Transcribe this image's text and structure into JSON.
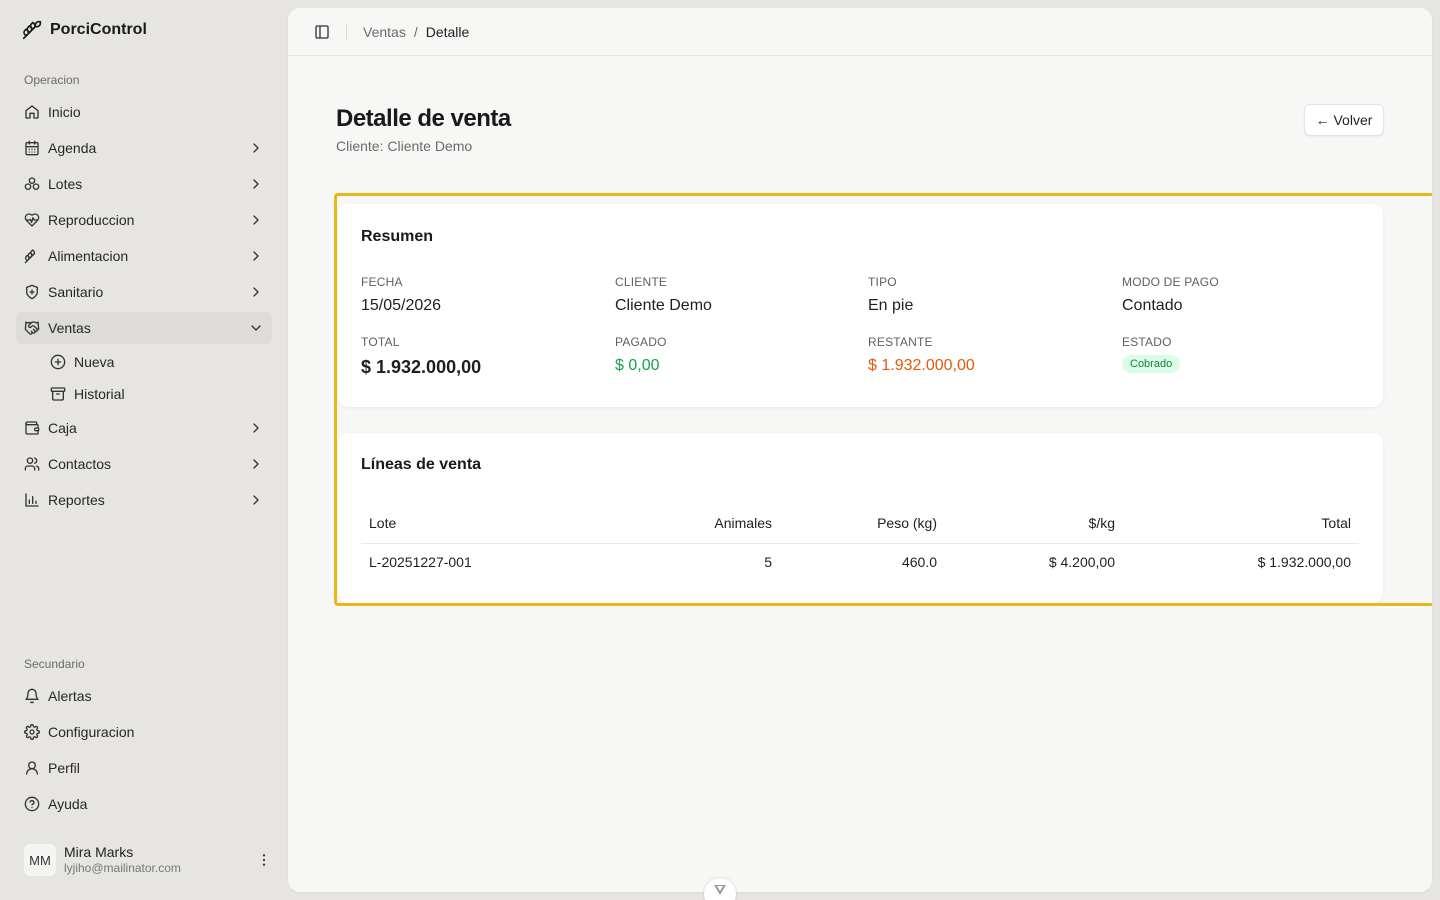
{
  "app": {
    "name": "PorciControl"
  },
  "sidebar": {
    "section_primary": "Operacion",
    "primary": [
      {
        "label": "Inicio",
        "icon": "home-icon"
      },
      {
        "label": "Agenda",
        "icon": "calendar-icon"
      },
      {
        "label": "Lotes",
        "icon": "boxes-icon"
      },
      {
        "label": "Reproduccion",
        "icon": "heart-pulse-icon"
      },
      {
        "label": "Alimentacion",
        "icon": "wheat-icon"
      },
      {
        "label": "Sanitario",
        "icon": "shield-icon"
      },
      {
        "label": "Ventas",
        "icon": "handshake-icon",
        "active": true
      }
    ],
    "ventas_sub": [
      {
        "label": "Nueva",
        "icon": "plus-circle-icon"
      },
      {
        "label": "Historial",
        "icon": "archive-icon"
      }
    ],
    "primary_after": [
      {
        "label": "Caja",
        "icon": "wallet-icon"
      },
      {
        "label": "Contactos",
        "icon": "users-icon"
      },
      {
        "label": "Reportes",
        "icon": "bar-chart-icon"
      }
    ],
    "section_secondary": "Secundario",
    "secondary": [
      {
        "label": "Alertas",
        "icon": "bell-icon"
      },
      {
        "label": "Configuracion",
        "icon": "gear-icon"
      },
      {
        "label": "Perfil",
        "icon": "user-icon"
      },
      {
        "label": "Ayuda",
        "icon": "help-circle-icon"
      }
    ],
    "user": {
      "initials": "MM",
      "name": "Mira Marks",
      "email": "lyjiho@mailinator.com"
    }
  },
  "header": {
    "breadcrumb_parent": "Ventas",
    "breadcrumb_separator": "/",
    "breadcrumb_current": "Detalle"
  },
  "page": {
    "title": "Detalle de venta",
    "subtitle": "Cliente: Cliente Demo",
    "back_label": "← Volver"
  },
  "summary": {
    "title": "Resumen",
    "fecha": {
      "label": "FECHA",
      "value": "15/05/2026"
    },
    "cliente": {
      "label": "CLIENTE",
      "value": "Cliente Demo"
    },
    "tipo": {
      "label": "TIPO",
      "value": "En pie"
    },
    "modo_pago": {
      "label": "MODO DE PAGO",
      "value": "Contado"
    },
    "total": {
      "label": "TOTAL",
      "value": "$ 1.932.000,00"
    },
    "pagado": {
      "label": "PAGADO",
      "value": "$ 0,00"
    },
    "restante": {
      "label": "RESTANTE",
      "value": "$ 1.932.000,00"
    },
    "estado": {
      "label": "ESTADO",
      "value": "Cobrado"
    }
  },
  "lines": {
    "title": "Líneas de venta",
    "columns": [
      "Lote",
      "Animales",
      "Peso (kg)",
      "$/kg",
      "Total"
    ],
    "rows": [
      [
        "L-20251227-001",
        "5",
        "460.0",
        "$ 4.200,00",
        "$ 1.932.000,00"
      ]
    ]
  },
  "colors": {
    "accent_highlight": "#e8b816",
    "paid_green": "#17a34a",
    "remaining_orange": "#ea580c",
    "badge_bg": "#dcfce7"
  }
}
